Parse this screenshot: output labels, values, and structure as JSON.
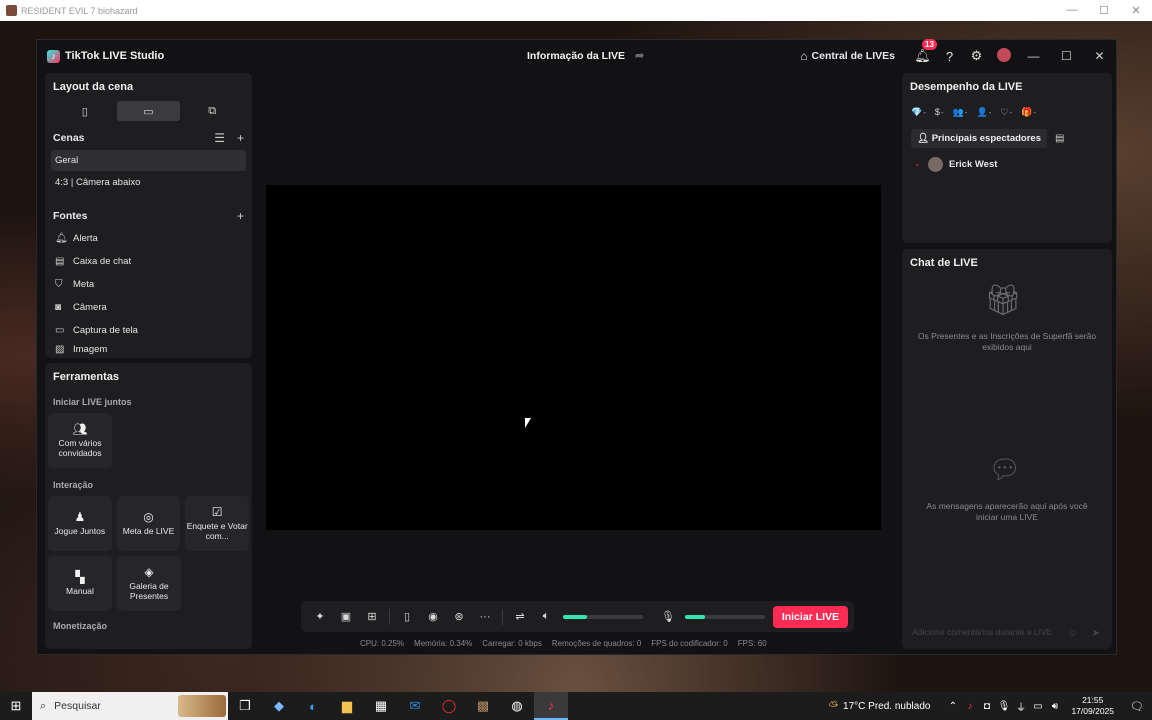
{
  "outer_window": {
    "title": "RESIDENT EVIL 7 biohazard",
    "controls": [
      "—",
      "☐",
      "✕"
    ]
  },
  "studio": {
    "app_name": "TikTok LIVE Studio",
    "live_info": "Informação da LIVE",
    "central": "Central de LIVEs",
    "notification_count": "13"
  },
  "layout": {
    "title": "Layout da cena",
    "options": [
      "▯",
      "▭",
      "⧉"
    ],
    "selected": 1
  },
  "scenes": {
    "title": "Cenas",
    "items": [
      "Geral",
      "4:3 | Câmera abaixo"
    ]
  },
  "sources": {
    "title": "Fontes",
    "items": [
      {
        "label": "Alerta",
        "icon": "bell-icon"
      },
      {
        "label": "Caixa de chat",
        "icon": "chat-box-icon"
      },
      {
        "label": "Meta",
        "icon": "goal-icon"
      },
      {
        "label": "Câmera",
        "icon": "camera-icon"
      },
      {
        "label": "Captura de tela",
        "icon": "monitor-icon"
      },
      {
        "label": "Imagem",
        "icon": "image-icon"
      }
    ]
  },
  "tools": {
    "title": "Ferramentas",
    "sections": [
      {
        "title": "Iniciar LIVE juntos",
        "items": [
          {
            "label": "Com vários convidados",
            "icon": "guests-icon"
          }
        ]
      },
      {
        "title": "Interação",
        "items": [
          {
            "label": "Jogue Juntos",
            "icon": "play-together-icon"
          },
          {
            "label": "Meta de LIVE",
            "icon": "target-icon"
          },
          {
            "label": "Enquete e Votar com...",
            "icon": "poll-icon"
          }
        ]
      },
      {
        "title": "",
        "items": [
          {
            "label": "Manual",
            "icon": "manual-icon"
          },
          {
            "label": "Galeria de Presentes",
            "icon": "gift-gallery-icon"
          }
        ]
      },
      {
        "title": "Monetização",
        "items": []
      }
    ]
  },
  "controls": {
    "start_label": "Iniciar LIVE",
    "speaker_level": 0.3,
    "mic_level": 0.25,
    "stats": [
      "CPU: 0.25%",
      "Memória: 0.34%",
      "Carregar: 0 kbps",
      "Remoções de quadros: 0",
      "FPS do codificador: 0",
      "FPS: 60"
    ]
  },
  "performance": {
    "title": "Desempenho da LIVE",
    "metrics": [
      "💎",
      "$",
      "👥",
      "👤",
      "♡",
      "🎁"
    ],
    "metric_value": "-",
    "tab": "Principais espectadores",
    "viewer": "Erick West",
    "viewer_rank": "-"
  },
  "chat": {
    "title": "Chat de LIVE",
    "gifts_empty": "Os Presentes e as Inscrições de Superfã serão exibidos aqui",
    "messages_empty": "As mensagens aparecerão aqui após você iniciar uma LIVE",
    "input_placeholder": "Adicione comentários durante a LIVE"
  },
  "taskbar": {
    "search_placeholder": "Pesquisar",
    "weather": "17°C  Pred. nublado",
    "time": "21:55",
    "date": "17/09/2025"
  }
}
